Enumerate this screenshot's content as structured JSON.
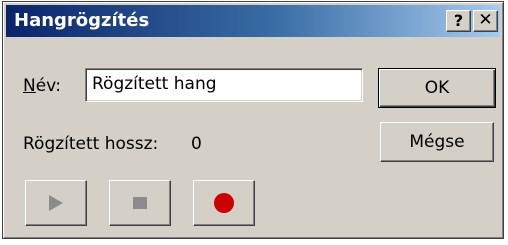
{
  "window": {
    "title": "Hangrögzítés",
    "help_symbol": "?",
    "close_symbol": "✕"
  },
  "form": {
    "name_label_accel": "N",
    "name_label_rest": "év:",
    "name_value": "Rögzített hang",
    "length_label": "Rögzített hossz:",
    "length_value": "0"
  },
  "buttons": {
    "ok_label": "OK",
    "cancel_label": "Mégse"
  },
  "media": {
    "play_icon": "play-icon",
    "stop_icon": "stop-icon",
    "record_icon": "record-icon",
    "record_color": "#cc0000",
    "disabled_color": "#8c8c8c"
  },
  "colors": {
    "titlebar_start": "#0a246a",
    "titlebar_end": "#a6caf0",
    "face": "#d4d0c8"
  }
}
